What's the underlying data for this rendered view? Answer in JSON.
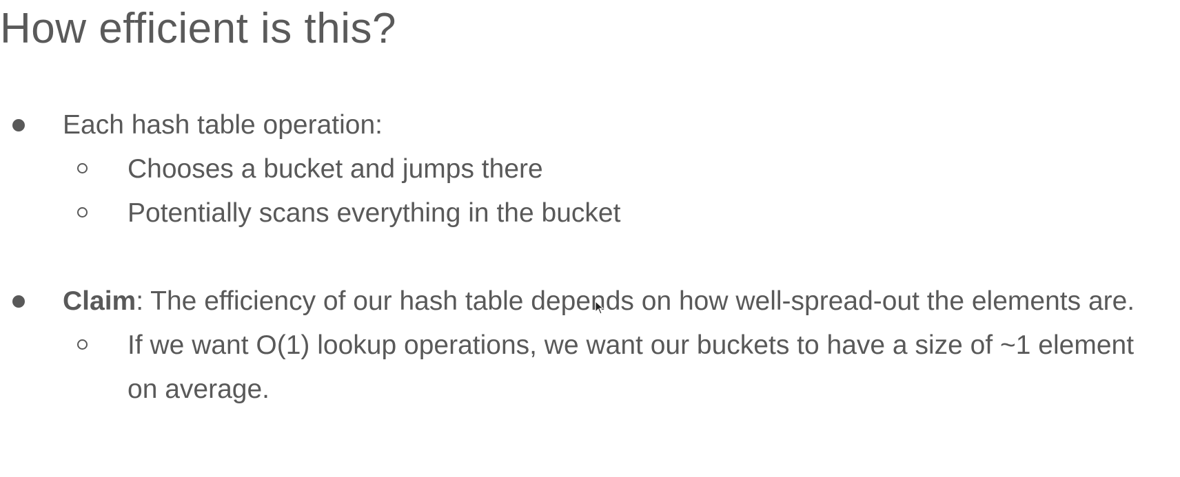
{
  "slide": {
    "title": "How efficient is this?",
    "bullets": [
      {
        "text": "Each hash table operation:",
        "sub_bullets": [
          "Chooses a bucket and jumps there",
          "Potentially scans everything in the bucket"
        ]
      },
      {
        "label": "Claim",
        "text": ": The efficiency of our hash table depends on how well-spread-out the elements are.",
        "sub_bullets": [
          "If we want O(1) lookup operations, we want our buckets to have a size of ~1 element on average."
        ]
      }
    ]
  },
  "icons": {
    "bullet": "filled-circle-bullet-icon",
    "sub_bullet": "hollow-circle-bullet-icon",
    "cursor": "mouse-pointer-icon"
  },
  "colors": {
    "text": "#595959",
    "background": "#ffffff"
  }
}
